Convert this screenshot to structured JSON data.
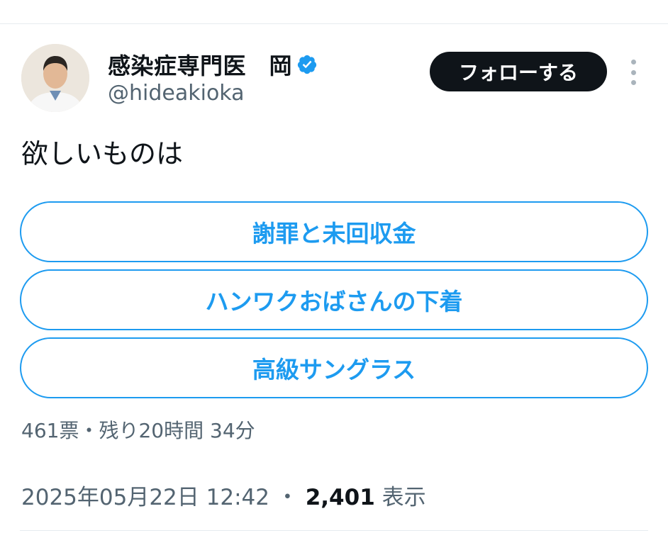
{
  "author": {
    "display_name": "感染症専門医　岡",
    "handle": "@hideakioka",
    "verified_color": "#1d9bf0"
  },
  "follow_button_label": "フォローする",
  "tweet": {
    "text": "欲しいものは"
  },
  "poll": {
    "options": [
      {
        "label": "謝罪と未回収金"
      },
      {
        "label": "ハンワクおばさんの下着"
      },
      {
        "label": "高級サングラス"
      }
    ],
    "votes": "461票",
    "separator": "・",
    "remaining": "残り20時間 34分"
  },
  "meta": {
    "timestamp": "2025年05月22日 12:42",
    "separator": "・",
    "views_count": "2,401",
    "views_label": "表示"
  },
  "colors": {
    "accent": "#1d9bf0",
    "text": "#0f1419",
    "secondary_text": "#536471"
  }
}
